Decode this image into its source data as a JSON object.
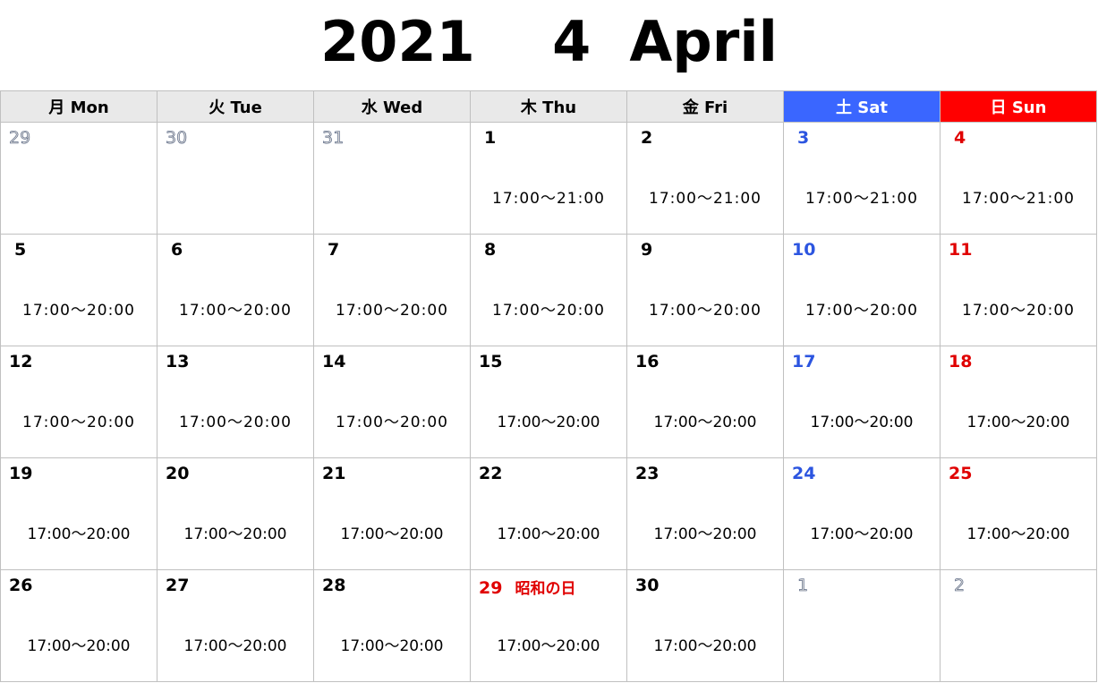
{
  "title": "2021    4  April",
  "weekdays": [
    {
      "label": "月 Mon",
      "type": "weekday"
    },
    {
      "label": "火 Tue",
      "type": "weekday"
    },
    {
      "label": "水 Wed",
      "type": "weekday"
    },
    {
      "label": "木 Thu",
      "type": "weekday"
    },
    {
      "label": "金 Fri",
      "type": "weekday"
    },
    {
      "label": "土 Sat",
      "type": "sat"
    },
    {
      "label": "日 Sun",
      "type": "sun"
    }
  ],
  "colors": {
    "saturday": "#3a66ff",
    "sunday": "#ff0000",
    "holiday": "#e00000",
    "header_bg": "#e9e9e9"
  },
  "weeks": [
    [
      {
        "day": "29",
        "type": "other",
        "time": ""
      },
      {
        "day": "30",
        "type": "other",
        "time": ""
      },
      {
        "day": "31",
        "type": "other",
        "time": ""
      },
      {
        "day": "1",
        "type": "normal",
        "time": "17:00～21:00",
        "indent": true,
        "wide": true
      },
      {
        "day": "2",
        "type": "normal",
        "time": "17:00～21:00",
        "indent": true,
        "wide": true
      },
      {
        "day": "3",
        "type": "sat",
        "time": "17:00～21:00",
        "indent": true,
        "wide": true
      },
      {
        "day": "4",
        "type": "sun",
        "time": "17:00～21:00",
        "indent": true,
        "wide": true
      }
    ],
    [
      {
        "day": "5",
        "type": "normal",
        "time": "17:00～20:00",
        "indent": true,
        "wide": true
      },
      {
        "day": "6",
        "type": "normal",
        "time": "17:00～20:00",
        "indent": true,
        "wide": true
      },
      {
        "day": "7",
        "type": "normal",
        "time": "17:00～20:00",
        "indent": true,
        "wide": true
      },
      {
        "day": "8",
        "type": "normal",
        "time": "17:00～20:00",
        "indent": true,
        "wide": true
      },
      {
        "day": "9",
        "type": "normal",
        "time": "17:00～20:00",
        "indent": true,
        "wide": true
      },
      {
        "day": "10",
        "type": "sat",
        "time": "17:00～20:00",
        "wide": true
      },
      {
        "day": "11",
        "type": "sun",
        "time": "17:00～20:00",
        "wide": true
      }
    ],
    [
      {
        "day": "12",
        "type": "normal",
        "time": "17:00～20:00",
        "wide": true
      },
      {
        "day": "13",
        "type": "normal",
        "time": "17:00～20:00",
        "wide": true
      },
      {
        "day": "14",
        "type": "normal",
        "time": "17:00～20:00",
        "wide": true
      },
      {
        "day": "15",
        "type": "normal",
        "time": "17:00～20:00"
      },
      {
        "day": "16",
        "type": "normal",
        "time": "17:00～20:00"
      },
      {
        "day": "17",
        "type": "sat",
        "time": "17:00～20:00"
      },
      {
        "day": "18",
        "type": "sun",
        "time": "17:00～20:00"
      }
    ],
    [
      {
        "day": "19",
        "type": "normal",
        "time": "17:00～20:00"
      },
      {
        "day": "20",
        "type": "normal",
        "time": "17:00～20:00"
      },
      {
        "day": "21",
        "type": "normal",
        "time": "17:00～20:00"
      },
      {
        "day": "22",
        "type": "normal",
        "time": "17:00～20:00"
      },
      {
        "day": "23",
        "type": "normal",
        "time": "17:00～20:00"
      },
      {
        "day": "24",
        "type": "sat",
        "time": "17:00～20:00"
      },
      {
        "day": "25",
        "type": "sun",
        "time": "17:00～20:00"
      }
    ],
    [
      {
        "day": "26",
        "type": "normal",
        "time": "17:00～20:00"
      },
      {
        "day": "27",
        "type": "normal",
        "time": "17:00～20:00"
      },
      {
        "day": "28",
        "type": "normal",
        "time": "17:00～20:00"
      },
      {
        "day": "29",
        "type": "hol",
        "holiday": "昭和の日",
        "time": "17:00～20:00"
      },
      {
        "day": "30",
        "type": "normal",
        "time": "17:00～20:00"
      },
      {
        "day": "1",
        "type": "other",
        "time": "",
        "indent": true
      },
      {
        "day": "2",
        "type": "other",
        "time": "",
        "indent": true
      }
    ]
  ]
}
